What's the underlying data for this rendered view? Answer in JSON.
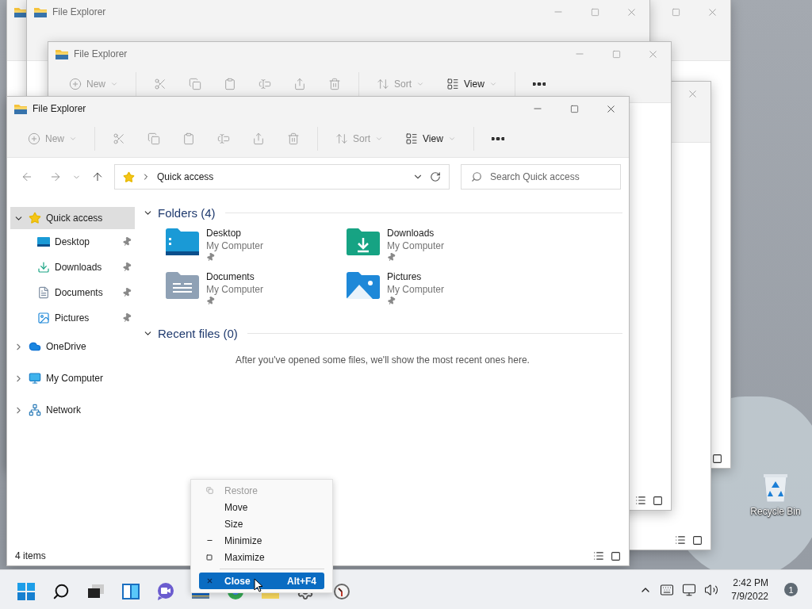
{
  "desktop": {
    "icons": [
      {
        "label": "Recycle Bin",
        "kind": "recycle"
      }
    ]
  },
  "background_windows": [
    {
      "kind": "icon_only"
    },
    {
      "kind": "titled",
      "title": "File Explorer"
    },
    {
      "kind": "edge"
    },
    {
      "kind": "titled",
      "title": "File Explorer",
      "toolbar": {
        "new": "New",
        "sort": "Sort",
        "view": "View"
      }
    }
  ],
  "window": {
    "title": "File Explorer",
    "toolbar": {
      "new": "New",
      "sort": "Sort",
      "view": "View"
    },
    "address": {
      "path": "Quick access"
    },
    "search": {
      "placeholder": "Search Quick access"
    },
    "sidebar": {
      "items": [
        {
          "label": "Quick access",
          "kind": "star",
          "selected": true,
          "expanded": true,
          "children": [
            {
              "label": "Desktop",
              "kind": "desktop",
              "selected": false,
              "pinned": true
            },
            {
              "label": "Downloads",
              "kind": "downloads",
              "selected": false,
              "pinned": true
            },
            {
              "label": "Documents",
              "kind": "documents",
              "selected": false,
              "pinned": true
            },
            {
              "label": "Pictures",
              "kind": "pictures",
              "selected": false,
              "pinned": true
            }
          ]
        },
        {
          "label": "OneDrive",
          "kind": "cloud",
          "selected": false,
          "expanded": false
        },
        {
          "label": "My Computer",
          "kind": "computer",
          "selected": false,
          "expanded": false
        },
        {
          "label": "Network",
          "kind": "network",
          "selected": false,
          "expanded": false
        }
      ]
    },
    "sections": [
      {
        "title": "Folders (4)",
        "expanded": true,
        "folders": [
          {
            "name": "Desktop",
            "location": "My Computer",
            "kind": "desktop",
            "pinned": true
          },
          {
            "name": "Downloads",
            "location": "My Computer",
            "kind": "downloads",
            "pinned": true
          },
          {
            "name": "Documents",
            "location": "My Computer",
            "kind": "documents",
            "pinned": true
          },
          {
            "name": "Pictures",
            "location": "My Computer",
            "kind": "pictures",
            "pinned": true
          }
        ]
      },
      {
        "title": "Recent files (0)",
        "expanded": true,
        "empty_message": "After you've opened some files, we'll show the most recent ones here."
      }
    ],
    "status_bar": {
      "items": "4 items"
    }
  },
  "context_menu": {
    "items": [
      {
        "kind": "restore",
        "label": "Restore",
        "disabled": true,
        "selected": false
      },
      {
        "kind": "plain",
        "label": "Move",
        "disabled": false,
        "selected": false
      },
      {
        "kind": "plain",
        "label": "Size",
        "disabled": false,
        "selected": false
      },
      {
        "kind": "minimize",
        "label": "Minimize",
        "disabled": false,
        "selected": false
      },
      {
        "kind": "maximize",
        "label": "Maximize",
        "disabled": false,
        "selected": false
      },
      {
        "kind": "separator"
      },
      {
        "kind": "close",
        "label": "Close",
        "shortcut": "Alt+F4",
        "disabled": false,
        "selected": true
      }
    ]
  },
  "taskbar": {
    "apps": [
      {
        "kind": "start"
      },
      {
        "kind": "search"
      },
      {
        "kind": "taskview"
      },
      {
        "kind": "widgets"
      },
      {
        "kind": "chat"
      },
      {
        "kind": "explorer"
      },
      {
        "kind": "browser"
      },
      {
        "kind": "folder"
      },
      {
        "kind": "settings"
      },
      {
        "kind": "clock"
      }
    ],
    "tray": {
      "time": "2:42 PM",
      "date": "7/9/2022",
      "notifications": "1"
    }
  }
}
